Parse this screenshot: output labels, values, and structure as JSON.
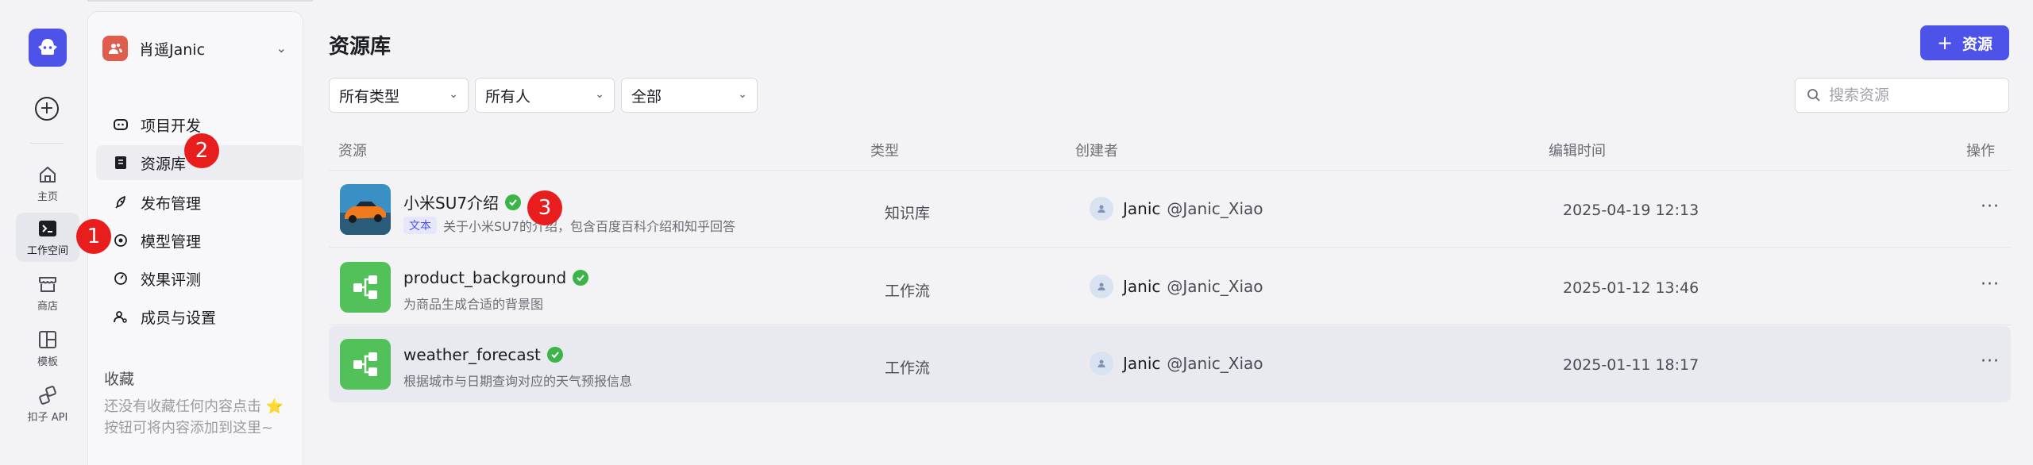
{
  "rail": {
    "items": [
      {
        "label": "主页",
        "icon": "home-icon"
      },
      {
        "label": "工作空间",
        "icon": "terminal-icon",
        "active": true
      },
      {
        "label": "商店",
        "icon": "store-icon"
      },
      {
        "label": "模板",
        "icon": "template-icon"
      },
      {
        "label": "扣子 API",
        "icon": "api-icon"
      }
    ]
  },
  "workspace": {
    "name": "肖遥Janic"
  },
  "nav": {
    "items": [
      {
        "label": "项目开发",
        "icon": "bot-icon"
      },
      {
        "label": "资源库",
        "icon": "library-icon",
        "active": true
      },
      {
        "label": "发布管理",
        "icon": "rocket-icon"
      },
      {
        "label": "模型管理",
        "icon": "model-icon"
      },
      {
        "label": "效果评测",
        "icon": "gauge-icon"
      },
      {
        "label": "成员与设置",
        "icon": "members-icon"
      }
    ]
  },
  "favorites": {
    "title": "收藏",
    "empty_text": "还没有收藏任何内容点击 ⭐ 按钮可将内容添加到这里~"
  },
  "page": {
    "title": "资源库",
    "add_label": "资源"
  },
  "filters": {
    "type": "所有类型",
    "owner": "所有人",
    "status": "全部"
  },
  "search": {
    "placeholder": "搜索资源"
  },
  "table": {
    "headers": {
      "resource": "资源",
      "type": "类型",
      "creator": "创建者",
      "edit_time": "编辑时间",
      "actions": "操作"
    },
    "rows": [
      {
        "name": "小米SU7介绍",
        "tag": "文本",
        "desc": "关于小米SU7的介绍，包含百度百科介绍和知乎回答",
        "type": "知识库",
        "creator_name": "Janic",
        "creator_handle": "@Janic_Xiao",
        "time": "2025-04-19 12:13",
        "thumb": "car-image"
      },
      {
        "name": "product_background",
        "tag": "",
        "desc": "为商品生成合适的背景图",
        "type": "工作流",
        "creator_name": "Janic",
        "creator_handle": "@Janic_Xiao",
        "time": "2025-01-12 13:46",
        "thumb": "workflow-icon"
      },
      {
        "name": "weather_forecast",
        "tag": "",
        "desc": "根据城市与日期查询对应的天气预报信息",
        "type": "工作流",
        "creator_name": "Janic",
        "creator_handle": "@Janic_Xiao",
        "time": "2025-01-11 18:17",
        "thumb": "workflow-icon"
      }
    ]
  },
  "annotations": [
    "1",
    "2",
    "3"
  ],
  "colors": {
    "accent": "#4d53e8",
    "badge": "#e81e1e",
    "workflow": "#52c15a",
    "verified": "#3bb54a"
  }
}
